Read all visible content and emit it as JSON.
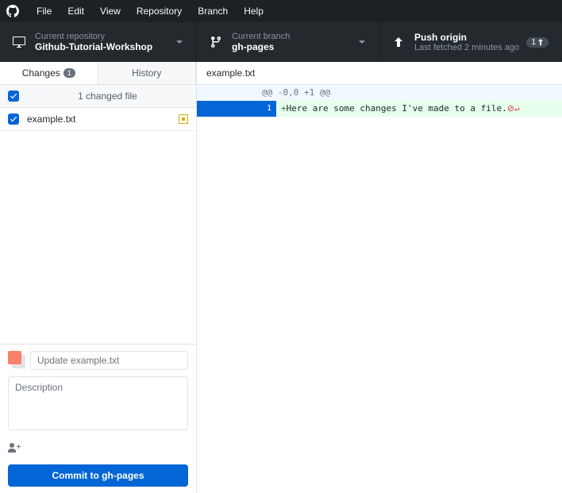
{
  "menubar": {
    "items": [
      "File",
      "Edit",
      "View",
      "Repository",
      "Branch",
      "Help"
    ]
  },
  "toolbar": {
    "repo": {
      "label": "Current repository",
      "value": "Github-Tutorial-Workshop"
    },
    "branch": {
      "label": "Current branch",
      "value": "gh-pages"
    },
    "push": {
      "label": "Push origin",
      "sub": "Last fetched 2 minutes ago",
      "badge_count": "1"
    }
  },
  "tabs": {
    "changes": {
      "label": "Changes",
      "count": "1"
    },
    "history": {
      "label": "History"
    }
  },
  "files": {
    "summary": "1 changed file",
    "items": [
      {
        "name": "example.txt",
        "status": "modified"
      }
    ]
  },
  "commit": {
    "summary_placeholder": "Update example.txt",
    "description_placeholder": "Description",
    "button_prefix": "Commit to ",
    "button_branch": "gh-pages"
  },
  "diff": {
    "filename": "example.txt",
    "hunk": "@@ -0,0 +1 @@",
    "lines": [
      {
        "new_num": "1",
        "sign": "+",
        "text": "Here are some changes I've made to a file.",
        "no_newline": true
      }
    ]
  }
}
